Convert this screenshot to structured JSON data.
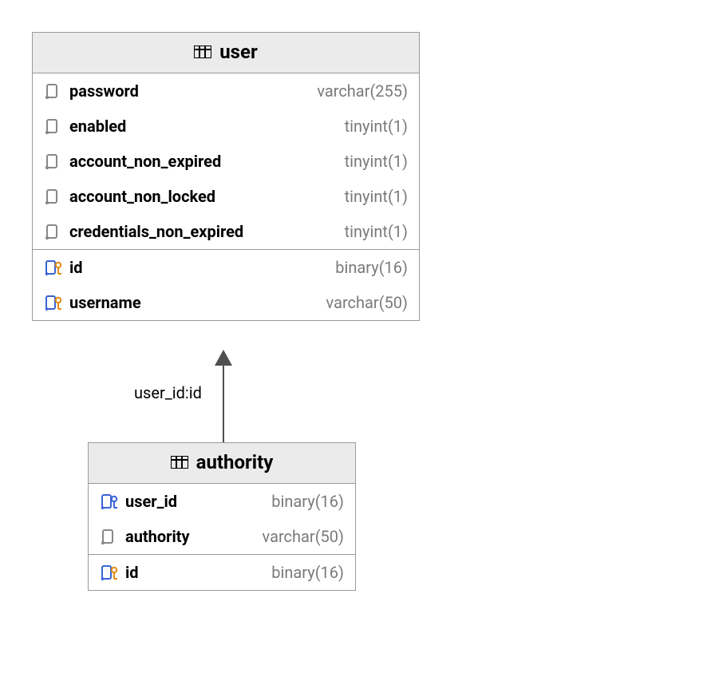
{
  "tables": {
    "user": {
      "title": "user",
      "cols_a": [
        {
          "name": "password",
          "type": "varchar(255)",
          "icon": "col"
        },
        {
          "name": "enabled",
          "type": "tinyint(1)",
          "icon": "col"
        },
        {
          "name": "account_non_expired",
          "type": "tinyint(1)",
          "icon": "col"
        },
        {
          "name": "account_non_locked",
          "type": "tinyint(1)",
          "icon": "col"
        },
        {
          "name": "credentials_non_expired",
          "type": "tinyint(1)",
          "icon": "col"
        }
      ],
      "cols_b": [
        {
          "name": "id",
          "type": "binary(16)",
          "icon": "pk"
        },
        {
          "name": "username",
          "type": "varchar(50)",
          "icon": "pk"
        }
      ]
    },
    "authority": {
      "title": "authority",
      "cols_a": [
        {
          "name": "user_id",
          "type": "binary(16)",
          "icon": "fk"
        },
        {
          "name": "authority",
          "type": "varchar(50)",
          "icon": "col"
        }
      ],
      "cols_b": [
        {
          "name": "id",
          "type": "binary(16)",
          "icon": "pk"
        }
      ]
    }
  },
  "relation": {
    "label": "user_id:id"
  }
}
